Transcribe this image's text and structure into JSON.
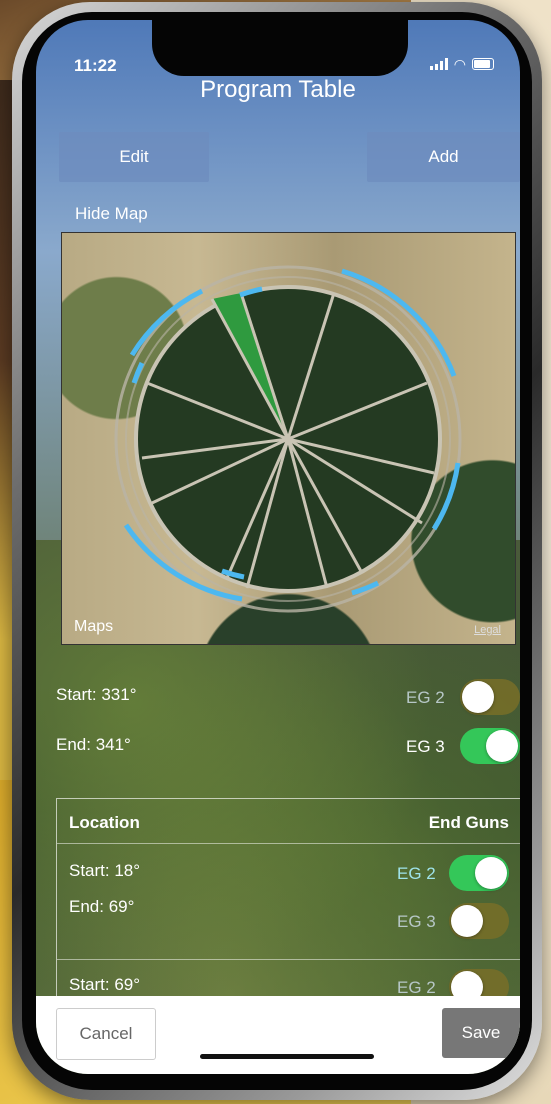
{
  "status_bar": {
    "time": "11:22"
  },
  "header": {
    "title": "Program Table"
  },
  "toolbar": {
    "edit_label": "Edit",
    "add_label": "Add"
  },
  "map": {
    "toggle_label": "Hide Map",
    "logo_text": "Maps",
    "legal_text": "Legal"
  },
  "selection": {
    "start_label": "Start: 331°",
    "end_label": "End:  341°",
    "eg2": {
      "label": "EG 2",
      "on": false
    },
    "eg3": {
      "label": "EG 3",
      "on": true
    }
  },
  "table": {
    "col_location": "Location",
    "col_end_guns": "End Guns",
    "rows": [
      {
        "start": "Start:   18°",
        "end": "End:    69°",
        "eg2": {
          "label": "EG 2",
          "on": true
        },
        "eg3": {
          "label": "EG 3",
          "on": false
        }
      },
      {
        "start": "Start:  69°",
        "eg2": {
          "label": "EG 2",
          "on": false
        }
      }
    ]
  },
  "footer": {
    "cancel_label": "Cancel",
    "save_label": "Save"
  },
  "colors": {
    "accent_green": "#34c759",
    "arc_blue": "#4db8f0",
    "wedge_green": "#2f9a3f"
  }
}
